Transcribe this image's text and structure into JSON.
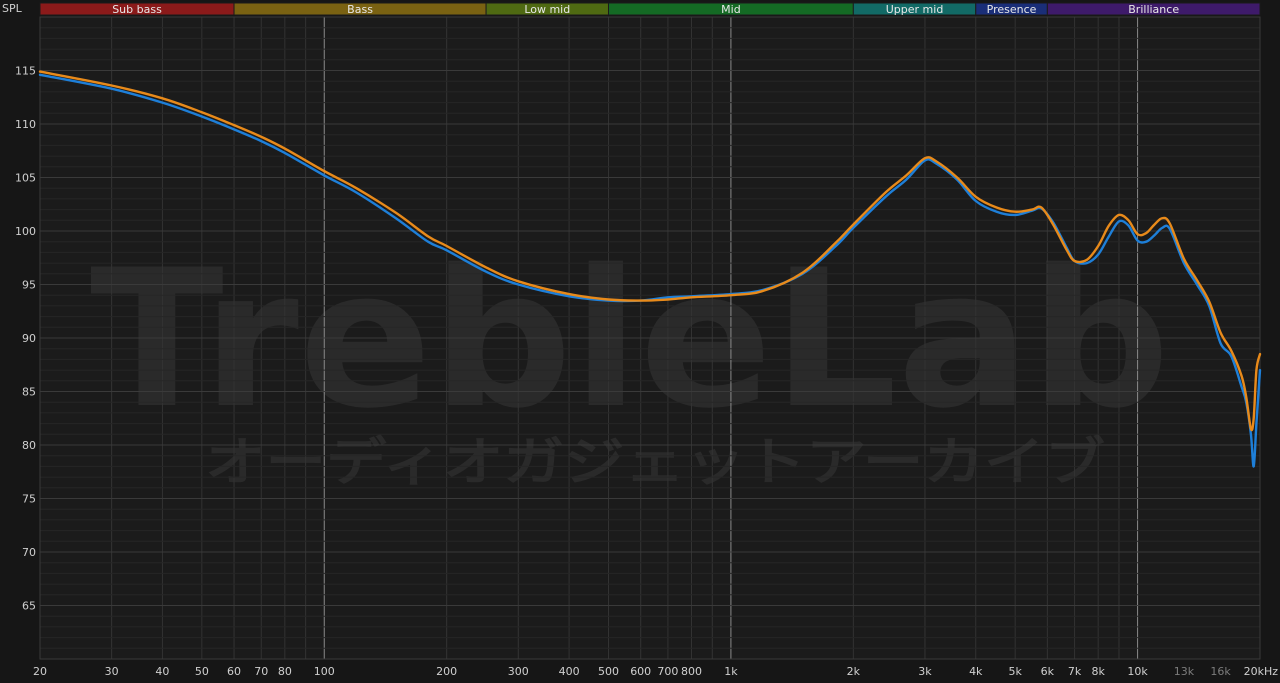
{
  "chart_data": {
    "type": "line",
    "ylabel": "SPL",
    "xscale": "log",
    "xlim": [
      20,
      20000
    ],
    "ylim": [
      60,
      120
    ],
    "grid": true,
    "x_ticks": [
      {
        "value": 20,
        "label": "20",
        "dim": false
      },
      {
        "value": 30,
        "label": "30",
        "dim": false
      },
      {
        "value": 40,
        "label": "40",
        "dim": false
      },
      {
        "value": 50,
        "label": "50",
        "dim": false
      },
      {
        "value": 60,
        "label": "60",
        "dim": false
      },
      {
        "value": 70,
        "label": "70",
        "dim": false
      },
      {
        "value": 80,
        "label": "80",
        "dim": false
      },
      {
        "value": 100,
        "label": "100",
        "dim": false
      },
      {
        "value": 200,
        "label": "200",
        "dim": false
      },
      {
        "value": 300,
        "label": "300",
        "dim": false
      },
      {
        "value": 400,
        "label": "400",
        "dim": false
      },
      {
        "value": 500,
        "label": "500",
        "dim": false
      },
      {
        "value": 600,
        "label": "600",
        "dim": false
      },
      {
        "value": 700,
        "label": "700",
        "dim": false
      },
      {
        "value": 800,
        "label": "800",
        "dim": false
      },
      {
        "value": 1000,
        "label": "1k",
        "dim": false
      },
      {
        "value": 2000,
        "label": "2k",
        "dim": false
      },
      {
        "value": 3000,
        "label": "3k",
        "dim": false
      },
      {
        "value": 4000,
        "label": "4k",
        "dim": false
      },
      {
        "value": 5000,
        "label": "5k",
        "dim": false
      },
      {
        "value": 6000,
        "label": "6k",
        "dim": false
      },
      {
        "value": 7000,
        "label": "7k",
        "dim": false
      },
      {
        "value": 8000,
        "label": "8k",
        "dim": false
      },
      {
        "value": 10000,
        "label": "10k",
        "dim": false
      },
      {
        "value": 13000,
        "label": "13k",
        "dim": true
      },
      {
        "value": 16000,
        "label": "16k",
        "dim": true
      },
      {
        "value": 20000,
        "label": "20kHz",
        "dim": false
      }
    ],
    "y_ticks": [
      65,
      70,
      75,
      80,
      85,
      90,
      95,
      100,
      105,
      110,
      115
    ],
    "bands": [
      {
        "name": "Sub bass",
        "from": 20,
        "to": 60,
        "color": "#8b1a1a"
      },
      {
        "name": "Bass",
        "from": 60,
        "to": 250,
        "color": "#7a6212"
      },
      {
        "name": "Low mid",
        "from": 250,
        "to": 500,
        "color": "#4f6a12"
      },
      {
        "name": "Mid",
        "from": 500,
        "to": 2000,
        "color": "#146a24"
      },
      {
        "name": "Upper mid",
        "from": 2000,
        "to": 4000,
        "color": "#126a66"
      },
      {
        "name": "Presence",
        "from": 4000,
        "to": 6000,
        "color": "#1a2e78"
      },
      {
        "name": "Brilliance",
        "from": 6000,
        "to": 20000,
        "color": "#3e1a6a"
      }
    ],
    "series": [
      {
        "color": "#1e7fd8",
        "points": [
          [
            20,
            114.6
          ],
          [
            30,
            113.3
          ],
          [
            40,
            112.0
          ],
          [
            50,
            110.7
          ],
          [
            60,
            109.5
          ],
          [
            70,
            108.4
          ],
          [
            80,
            107.3
          ],
          [
            100,
            105.2
          ],
          [
            120,
            103.6
          ],
          [
            150,
            101.2
          ],
          [
            180,
            99.0
          ],
          [
            200,
            98.2
          ],
          [
            250,
            96.2
          ],
          [
            300,
            95.0
          ],
          [
            400,
            93.9
          ],
          [
            500,
            93.5
          ],
          [
            600,
            93.5
          ],
          [
            700,
            93.8
          ],
          [
            800,
            93.9
          ],
          [
            1000,
            94.1
          ],
          [
            1200,
            94.5
          ],
          [
            1500,
            96.0
          ],
          [
            1800,
            98.5
          ],
          [
            2000,
            100.3
          ],
          [
            2400,
            103.2
          ],
          [
            2700,
            104.8
          ],
          [
            3000,
            106.6
          ],
          [
            3200,
            106.3
          ],
          [
            3600,
            104.8
          ],
          [
            4000,
            102.8
          ],
          [
            4500,
            101.8
          ],
          [
            5000,
            101.5
          ],
          [
            5500,
            101.9
          ],
          [
            5800,
            102.1
          ],
          [
            6200,
            100.8
          ],
          [
            6700,
            98.4
          ],
          [
            7000,
            97.2
          ],
          [
            7500,
            97.0
          ],
          [
            8000,
            97.8
          ],
          [
            8500,
            99.5
          ],
          [
            9000,
            100.9
          ],
          [
            9500,
            100.5
          ],
          [
            10000,
            99.1
          ],
          [
            10500,
            99.0
          ],
          [
            11000,
            99.6
          ],
          [
            11500,
            100.3
          ],
          [
            12000,
            100.2
          ],
          [
            13000,
            97.0
          ],
          [
            14000,
            95.0
          ],
          [
            15000,
            93.0
          ],
          [
            16000,
            89.5
          ],
          [
            17000,
            88.3
          ],
          [
            18000,
            85.5
          ],
          [
            18500,
            84.0
          ],
          [
            19000,
            81.0
          ],
          [
            19300,
            78.0
          ],
          [
            19600,
            82.0
          ],
          [
            20000,
            87.0
          ]
        ]
      },
      {
        "color": "#e88a1a",
        "points": [
          [
            20,
            114.9
          ],
          [
            30,
            113.6
          ],
          [
            40,
            112.4
          ],
          [
            50,
            111.1
          ],
          [
            60,
            109.9
          ],
          [
            70,
            108.8
          ],
          [
            80,
            107.7
          ],
          [
            100,
            105.6
          ],
          [
            120,
            104.0
          ],
          [
            150,
            101.7
          ],
          [
            180,
            99.5
          ],
          [
            200,
            98.6
          ],
          [
            250,
            96.6
          ],
          [
            300,
            95.3
          ],
          [
            400,
            94.1
          ],
          [
            500,
            93.6
          ],
          [
            600,
            93.5
          ],
          [
            700,
            93.6
          ],
          [
            800,
            93.8
          ],
          [
            1000,
            94.0
          ],
          [
            1200,
            94.4
          ],
          [
            1500,
            96.1
          ],
          [
            1800,
            98.8
          ],
          [
            2000,
            100.6
          ],
          [
            2400,
            103.6
          ],
          [
            2700,
            105.2
          ],
          [
            3000,
            106.8
          ],
          [
            3200,
            106.5
          ],
          [
            3600,
            105.0
          ],
          [
            4000,
            103.2
          ],
          [
            4500,
            102.2
          ],
          [
            5000,
            101.8
          ],
          [
            5500,
            102.0
          ],
          [
            5800,
            102.2
          ],
          [
            6200,
            100.6
          ],
          [
            6700,
            98.2
          ],
          [
            7000,
            97.2
          ],
          [
            7500,
            97.3
          ],
          [
            8000,
            98.6
          ],
          [
            8500,
            100.5
          ],
          [
            9000,
            101.5
          ],
          [
            9500,
            101.0
          ],
          [
            10000,
            99.7
          ],
          [
            10500,
            99.8
          ],
          [
            11000,
            100.6
          ],
          [
            11500,
            101.2
          ],
          [
            12000,
            100.7
          ],
          [
            13000,
            97.4
          ],
          [
            14000,
            95.4
          ],
          [
            15000,
            93.4
          ],
          [
            16000,
            90.5
          ],
          [
            17000,
            88.8
          ],
          [
            18000,
            86.5
          ],
          [
            18500,
            84.5
          ],
          [
            19000,
            81.5
          ],
          [
            19300,
            82.5
          ],
          [
            19600,
            87.0
          ],
          [
            20000,
            88.5
          ]
        ]
      }
    ]
  }
}
